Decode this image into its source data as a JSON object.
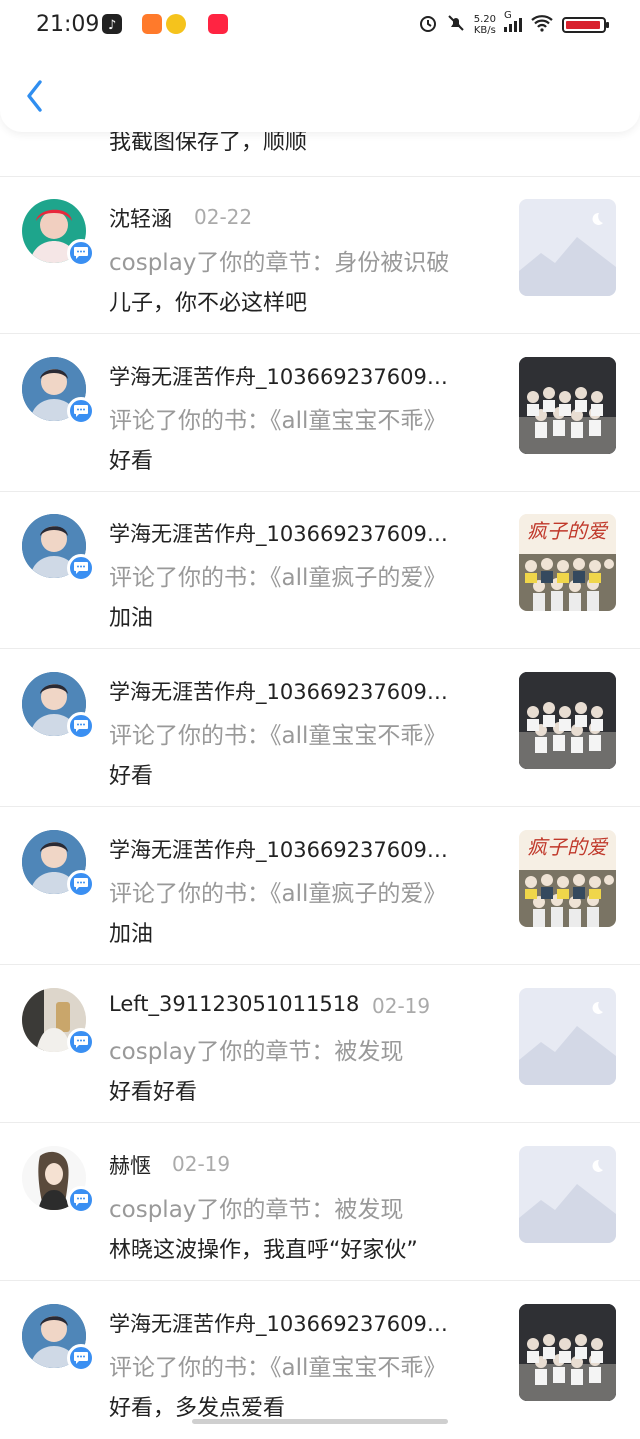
{
  "status_bar": {
    "time": "21:09",
    "speed_value": "5.20",
    "speed_unit": "KB/s",
    "signal_label": "G"
  },
  "header": {
    "back_icon": "chevron-left-icon"
  },
  "top_partial_comment": "我截图保存了，顺顺",
  "rows": [
    {
      "name": "沈轻涵",
      "date": "02-22",
      "action": "cosplay了你的章节：身份被识破",
      "comment": "儿子，你不必这样吧"
    },
    {
      "name": "学海无涯苦作舟_103669237609…",
      "date": "",
      "action": "评论了你的书：《all童宝宝不乖》",
      "comment": "好看"
    },
    {
      "name": "学海无涯苦作舟_103669237609…",
      "date": "",
      "action": "评论了你的书：《all童疯子的爱》",
      "comment": "加油"
    },
    {
      "name": "学海无涯苦作舟_103669237609…",
      "date": "",
      "action": "评论了你的书：《all童宝宝不乖》",
      "comment": "好看"
    },
    {
      "name": "学海无涯苦作舟_103669237609…",
      "date": "",
      "action": "评论了你的书：《all童疯子的爱》",
      "comment": "加油"
    },
    {
      "name": "Left_391123051011518",
      "date": "02-19",
      "action": "cosplay了你的章节：被发现",
      "comment": "好看好看"
    },
    {
      "name": "赫惬",
      "date": "02-19",
      "action": "cosplay了你的章节：被发现",
      "comment": "林晓这波操作，我直呼“好家伙”"
    },
    {
      "name": "学海无涯苦作舟_103669237609…",
      "date": "",
      "action": "评论了你的书：《all童宝宝不乖》",
      "comment": "好看，多发点爱看"
    }
  ],
  "cover_title": "疯子的爱",
  "colors": {
    "accent": "#3a8ff2",
    "secondary_text": "#999999",
    "date_text": "#aaaaaa",
    "divider": "#ececec"
  }
}
